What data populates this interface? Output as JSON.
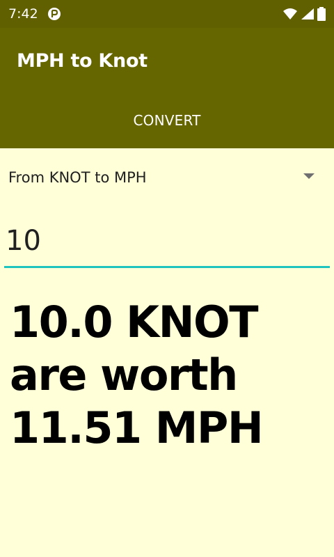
{
  "status_bar": {
    "time": "7:42",
    "icons": [
      "notification-icon",
      "wifi-icon",
      "signal-icon",
      "battery-icon"
    ]
  },
  "app_bar": {
    "title": "MPH to Knot"
  },
  "tabs": [
    {
      "label": "CONVERT"
    }
  ],
  "conversion": {
    "selected_option": "From KNOT to MPH",
    "input_value": "10",
    "result_text": "10.0 KNOT are worth 11.51 MPH"
  },
  "colors": {
    "status_bar": "#606000",
    "app_bar": "#666600",
    "background": "#FFFFD8",
    "accent": "#20C4BE"
  }
}
